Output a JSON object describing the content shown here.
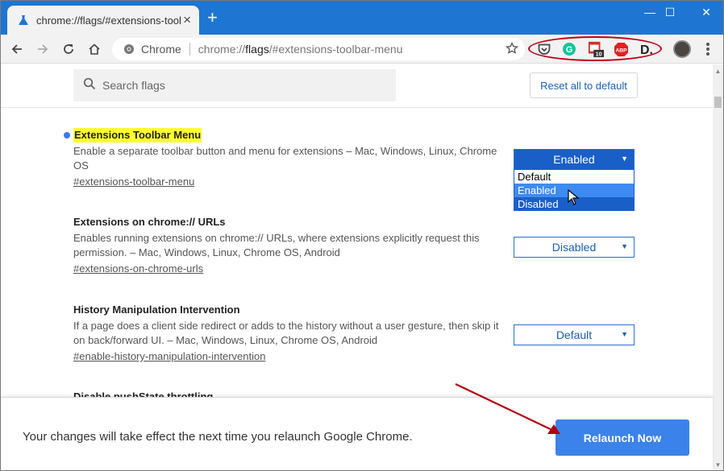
{
  "tab": {
    "title": "chrome://flags/#extensions-toolbar-menu",
    "close": "×",
    "new_tab": "+"
  },
  "window": {
    "minimize": "—",
    "maximize": "☐",
    "close": "✕"
  },
  "omnibox": {
    "origin": "Chrome",
    "url_prefix": "chrome://",
    "url_host": "flags",
    "url_rest": "/#extensions-toolbar-menu"
  },
  "extensions": [
    {
      "name": "pocket-icon"
    },
    {
      "name": "grammarly-icon",
      "label": "G"
    },
    {
      "name": "calendar-icon",
      "badge": "10"
    },
    {
      "name": "adblock-plus-icon",
      "label": "ABP"
    },
    {
      "name": "d-extension-icon",
      "label": "D."
    }
  ],
  "header": {
    "search_placeholder": "Search flags",
    "reset_label": "Reset all to default"
  },
  "flags": [
    {
      "title": "Extensions Toolbar Menu",
      "desc": "Enable a separate toolbar button and menu for extensions – Mac, Windows, Linux, Chrome OS",
      "link": "#extensions-toolbar-menu",
      "value": "Enabled",
      "options": [
        "Default",
        "Enabled",
        "Disabled"
      ]
    },
    {
      "title": "Extensions on chrome:// URLs",
      "desc": "Enables running extensions on chrome:// URLs, where extensions explicitly request this permission. – Mac, Windows, Linux, Chrome OS, Android",
      "link": "#extensions-on-chrome-urls",
      "value": "Disabled"
    },
    {
      "title": "History Manipulation Intervention",
      "desc": "If a page does a client side redirect or adds to the history without a user gesture, then skip it on back/forward UI. – Mac, Windows, Linux, Chrome OS, Android",
      "link": "#enable-history-manipulation-intervention",
      "value": "Default"
    },
    {
      "title": "Disable pushState throttling"
    }
  ],
  "footer": {
    "message": "Your changes will take effect the next time you relaunch Google Chrome.",
    "relaunch_label": "Relaunch Now"
  },
  "colors": {
    "titlebar": "#1e76d2",
    "accent": "#1a5fc8",
    "highlight": "#ffff33",
    "annotation": "#c00018"
  }
}
